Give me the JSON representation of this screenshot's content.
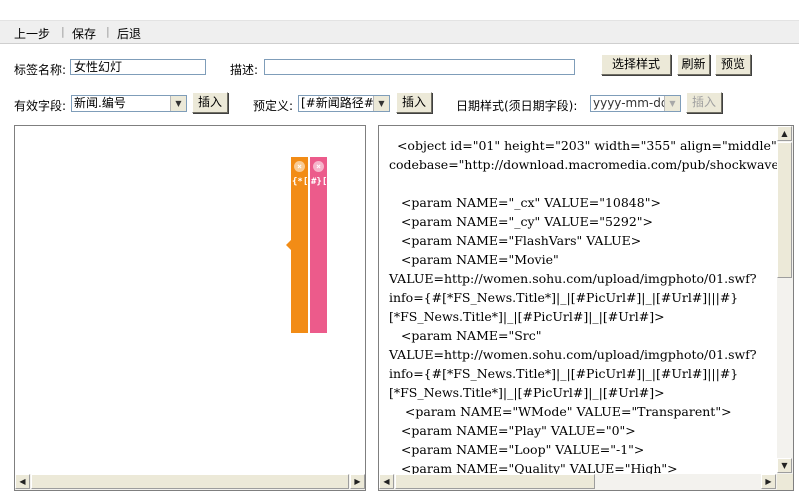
{
  "toolbar": {
    "back_label": "上一步",
    "save_label": "保存",
    "undo_label": "后退",
    "separator": "|"
  },
  "form": {
    "tag_name_label": "标签名称:",
    "tag_name_value": "女性幻灯",
    "desc_label": "描述:",
    "desc_value": "",
    "select_style_label": "选择样式",
    "refresh_label": "刷新",
    "preview_label": "预览",
    "valid_field_label": "有效字段:",
    "valid_field_value": "新闻.编号",
    "insert_label": "插入",
    "predefined_label": "预定义:",
    "predefined_value": "[#新闻路径#",
    "date_style_label": "日期样式(须日期字段):",
    "date_style_value": "yyyy-mm-dd"
  },
  "preview_panel": {
    "ribbon_orange_text": "{*[*FS_News.Ti",
    "ribbon_pink_text": "#}[*FS_News.Ti",
    "ribbon_orange_color": "#f28c16",
    "ribbon_pink_color": "#ec5b8b"
  },
  "code_panel": {
    "lines": [
      "  <object id=\"01\" height=\"203\" width=\"355\" align=\"middle\"",
      "codebase=\"http://download.macromedia.com/pub/shockwave/ca",
      "",
      "   <param NAME=\"_cx\" VALUE=\"10848\">",
      "   <param NAME=\"_cy\" VALUE=\"5292\">",
      "   <param NAME=\"FlashVars\" VALUE>",
      "   <param NAME=\"Movie\"",
      "VALUE=http://women.sohu.com/upload/imgphoto/01.swf?",
      "info={#[*FS_News.Title*]|_|[#PicUrl#]|_|[#Url#]|||#}",
      "[*FS_News.Title*]|_|[#PicUrl#]|_|[#Url#]>",
      "   <param NAME=\"Src\"",
      "VALUE=http://women.sohu.com/upload/imgphoto/01.swf?",
      "info={#[*FS_News.Title*]|_|[#PicUrl#]|_|[#Url#]|||#}",
      "[*FS_News.Title*]|_|[#PicUrl#]|_|[#Url#]>",
      "    <param NAME=\"WMode\" VALUE=\"Transparent\">",
      "   <param NAME=\"Play\" VALUE=\"0\">",
      "   <param NAME=\"Loop\" VALUE=\"-1\">",
      "   <param NAME=\"Quality\" VALUE=\"High\">"
    ]
  },
  "icons": {
    "scroll_up": "▲",
    "scroll_down": "▼",
    "scroll_left": "◀",
    "scroll_right": "▶",
    "dropdown": "▼",
    "ribbon_close": "×"
  }
}
